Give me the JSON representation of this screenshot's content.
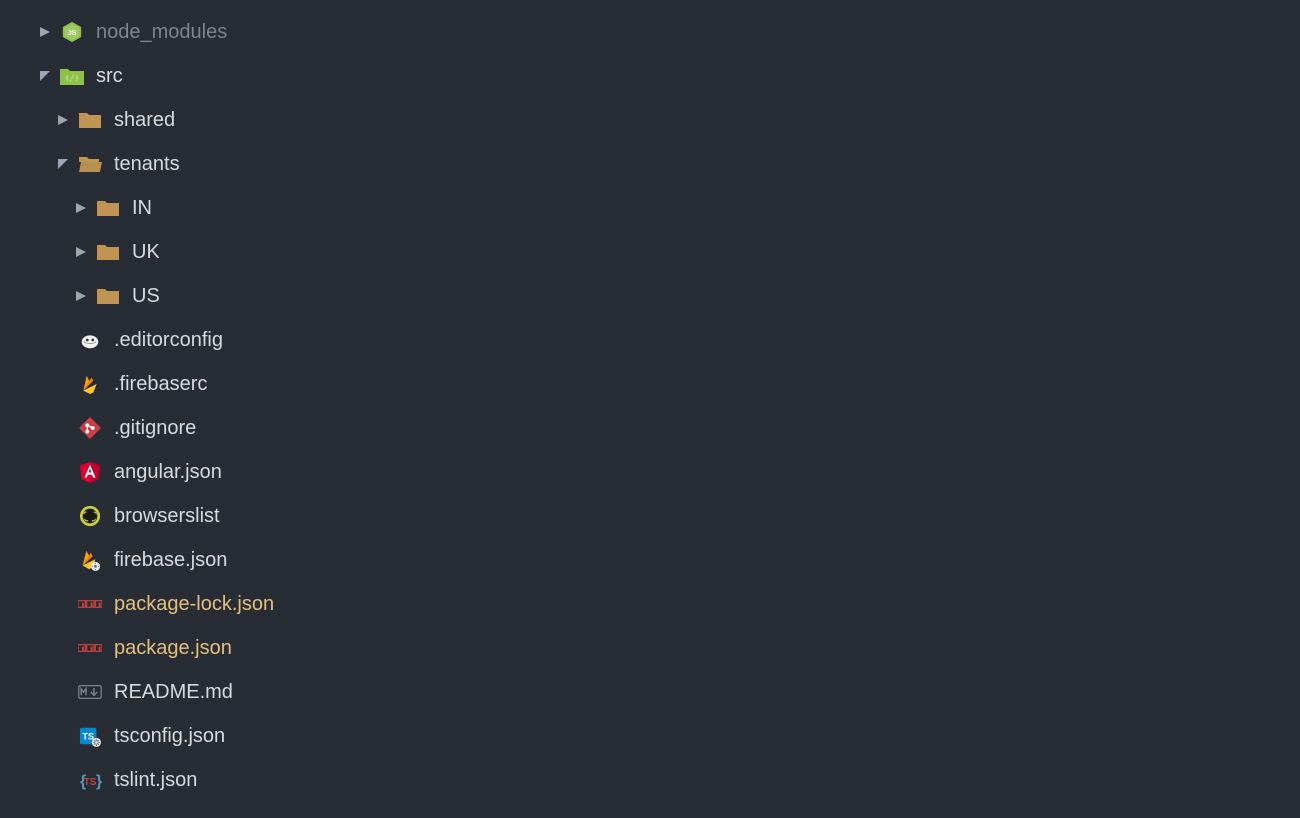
{
  "colors": {
    "bg": "#282c34",
    "text": "#d7dae0",
    "dim": "#7f848e",
    "highlight": "#e5c07b",
    "folder": "#c09553",
    "green": "#8dc149",
    "red": "#cc3e44",
    "blue": "#519aba",
    "orange": "#e37933",
    "yellow": "#cbcb41"
  },
  "tree": [
    {
      "label": "node_modules",
      "depth": 0,
      "chevron": "right",
      "icon": "nodejs",
      "style": "dim"
    },
    {
      "label": "src",
      "depth": 0,
      "chevron": "down",
      "icon": "src-folder",
      "style": "folder"
    },
    {
      "label": "shared",
      "depth": 1,
      "chevron": "right",
      "icon": "folder-closed",
      "style": "folder"
    },
    {
      "label": "tenants",
      "depth": 1,
      "chevron": "down",
      "icon": "folder-open",
      "style": "folder"
    },
    {
      "label": "IN",
      "depth": 2,
      "chevron": "right",
      "icon": "folder-closed",
      "style": "folder"
    },
    {
      "label": "UK",
      "depth": 2,
      "chevron": "right",
      "icon": "folder-closed",
      "style": "folder"
    },
    {
      "label": "US",
      "depth": 2,
      "chevron": "right",
      "icon": "folder-closed",
      "style": "folder"
    },
    {
      "label": ".editorconfig",
      "depth": 1,
      "chevron": "none",
      "icon": "editorconfig",
      "style": "normal"
    },
    {
      "label": ".firebaserc",
      "depth": 1,
      "chevron": "none",
      "icon": "firebase",
      "style": "normal"
    },
    {
      "label": ".gitignore",
      "depth": 1,
      "chevron": "none",
      "icon": "git",
      "style": "normal"
    },
    {
      "label": "angular.json",
      "depth": 1,
      "chevron": "none",
      "icon": "angular",
      "style": "normal"
    },
    {
      "label": "browserslist",
      "depth": 1,
      "chevron": "none",
      "icon": "browserslist",
      "style": "normal"
    },
    {
      "label": "firebase.json",
      "depth": 1,
      "chevron": "none",
      "icon": "firebase-json",
      "style": "normal"
    },
    {
      "label": "package-lock.json",
      "depth": 1,
      "chevron": "none",
      "icon": "npm",
      "style": "highlight"
    },
    {
      "label": "package.json",
      "depth": 1,
      "chevron": "none",
      "icon": "npm",
      "style": "highlight"
    },
    {
      "label": "README.md",
      "depth": 1,
      "chevron": "none",
      "icon": "markdown",
      "style": "normal"
    },
    {
      "label": "tsconfig.json",
      "depth": 1,
      "chevron": "none",
      "icon": "tsconfig",
      "style": "normal"
    },
    {
      "label": "tslint.json",
      "depth": 1,
      "chevron": "none",
      "icon": "tslint",
      "style": "normal"
    }
  ]
}
